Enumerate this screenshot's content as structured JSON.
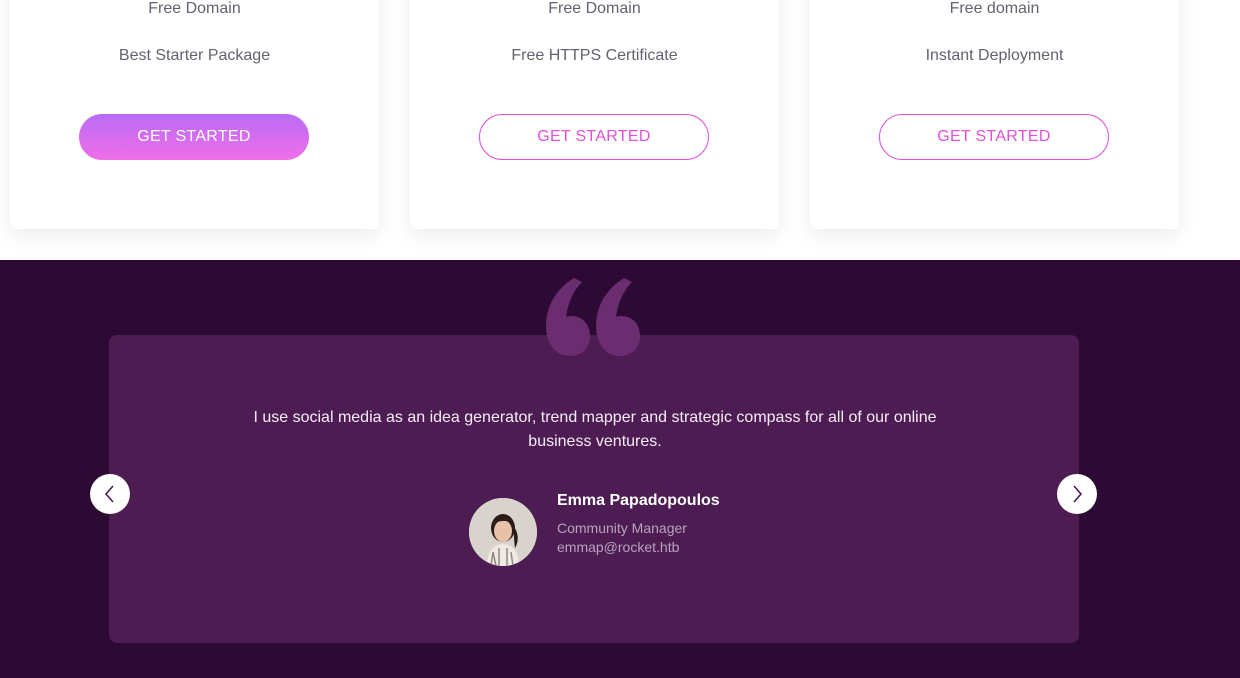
{
  "pricing": {
    "cards": [
      {
        "features": [
          "Free Domain",
          "Best Starter Package"
        ],
        "cta_label": "GET STARTED",
        "highlighted": true
      },
      {
        "features": [
          "Free Domain",
          "Free HTTPS Certificate"
        ],
        "cta_label": "GET STARTED",
        "highlighted": false
      },
      {
        "features": [
          "Free domain",
          "Instant Deployment"
        ],
        "cta_label": "GET STARTED",
        "highlighted": false
      }
    ]
  },
  "testimonial": {
    "quote": "I use social media as an idea generator, trend mapper and strategic compass for all of our online business ventures.",
    "name": "Emma Papadopoulos",
    "role": "Community Manager",
    "email": "emmap@rocket.htb",
    "icons": {
      "quote": "quote-icon",
      "prev": "chevron-left-icon",
      "next": "chevron-right-icon",
      "avatar": "avatar"
    }
  },
  "colors": {
    "accent": "#e34fd9",
    "gradient_start": "#b86bf5",
    "gradient_end": "#f06fe8",
    "section_bg": "#2c0a33",
    "card_bg": "#4d1c53",
    "quote_icon": "#6a2d70"
  }
}
